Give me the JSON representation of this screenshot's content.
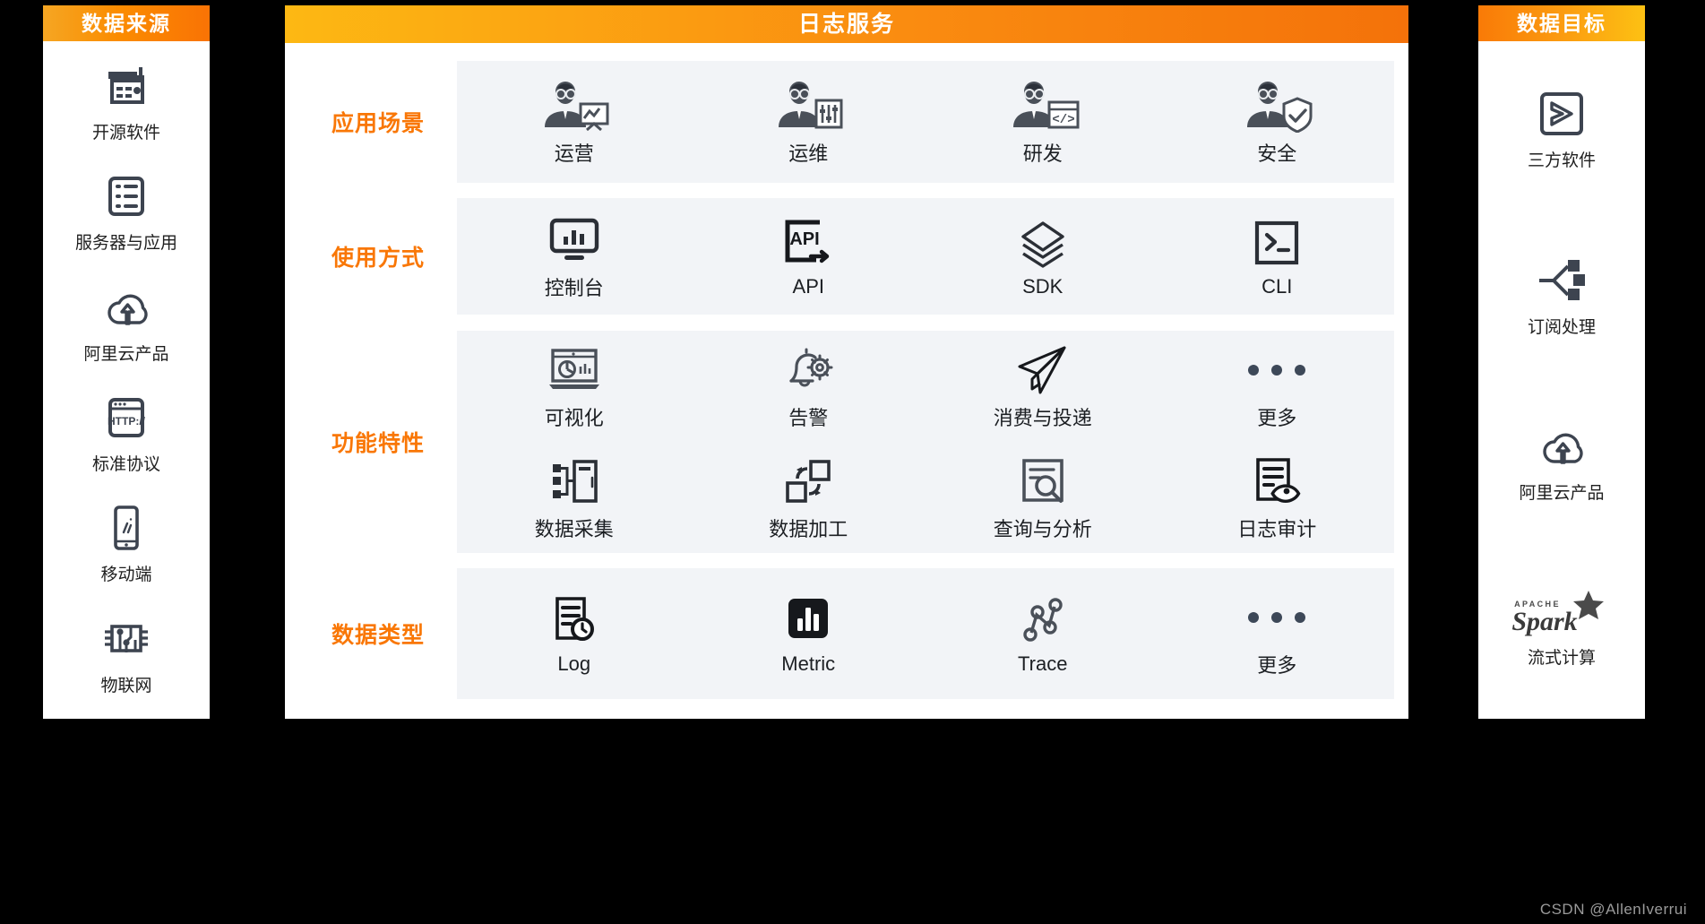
{
  "colors": {
    "background": "#000000",
    "panel": "#ffffff",
    "header_orange": "#f97706",
    "header_yellow": "#fdb813",
    "card_bg": "#f2f4f7",
    "icon_dark": "#3d4450",
    "label_text": "#1c1f23",
    "watermark": "#9a9a9a"
  },
  "left_panel": {
    "title": "数据来源",
    "items": [
      {
        "label": "开源软件",
        "icon": "open-source-server-icon"
      },
      {
        "label": "服务器与应用",
        "icon": "server-rack-icon"
      },
      {
        "label": "阿里云产品",
        "icon": "cloud-upload-icon"
      },
      {
        "label": "标准协议",
        "icon": "http-browser-icon"
      },
      {
        "label": "移动端",
        "icon": "mobile-phone-icon"
      },
      {
        "label": "物联网",
        "icon": "iot-chip-icon"
      }
    ]
  },
  "center_panel": {
    "title": "日志服务",
    "bands": [
      {
        "label": "应用场景",
        "rows": [
          [
            {
              "label": "运营",
              "icon": "person-chart-icon"
            },
            {
              "label": "运维",
              "icon": "person-sliders-icon"
            },
            {
              "label": "研发",
              "icon": "person-code-icon"
            },
            {
              "label": "安全",
              "icon": "person-shield-icon"
            }
          ]
        ]
      },
      {
        "label": "使用方式",
        "rows": [
          [
            {
              "label": "控制台",
              "icon": "console-monitor-icon"
            },
            {
              "label": "API",
              "icon": "api-icon"
            },
            {
              "label": "SDK",
              "icon": "layers-icon"
            },
            {
              "label": "CLI",
              "icon": "terminal-icon"
            }
          ]
        ]
      },
      {
        "label": "功能特性",
        "rows": [
          [
            {
              "label": "可视化",
              "icon": "dashboard-chart-icon"
            },
            {
              "label": "告警",
              "icon": "bell-gear-icon"
            },
            {
              "label": "消费与投递",
              "icon": "paper-plane-icon"
            },
            {
              "label": "更多",
              "icon": "more-dots-icon"
            }
          ],
          [
            {
              "label": "数据采集",
              "icon": "data-collect-icon"
            },
            {
              "label": "数据加工",
              "icon": "data-transform-icon"
            },
            {
              "label": "查询与分析",
              "icon": "search-document-icon"
            },
            {
              "label": "日志审计",
              "icon": "log-audit-eye-icon"
            }
          ]
        ]
      },
      {
        "label": "数据类型",
        "rows": [
          [
            {
              "label": "Log",
              "icon": "log-clock-icon"
            },
            {
              "label": "Metric",
              "icon": "metric-bars-icon"
            },
            {
              "label": "Trace",
              "icon": "trace-nodes-icon"
            },
            {
              "label": "更多",
              "icon": "more-dots-icon"
            }
          ]
        ]
      }
    ]
  },
  "right_panel": {
    "title": "数据目标",
    "items": [
      {
        "label": "三方软件",
        "icon": "third-party-software-icon"
      },
      {
        "label": "订阅处理",
        "icon": "subscribe-fanout-icon"
      },
      {
        "label": "阿里云产品",
        "icon": "cloud-upload-icon"
      },
      {
        "label": "流式计算",
        "icon": "apache-spark-logo",
        "logo_sub": "APACHE",
        "logo_main": "Spark"
      }
    ]
  },
  "watermark": "CSDN @AllenIverrui"
}
